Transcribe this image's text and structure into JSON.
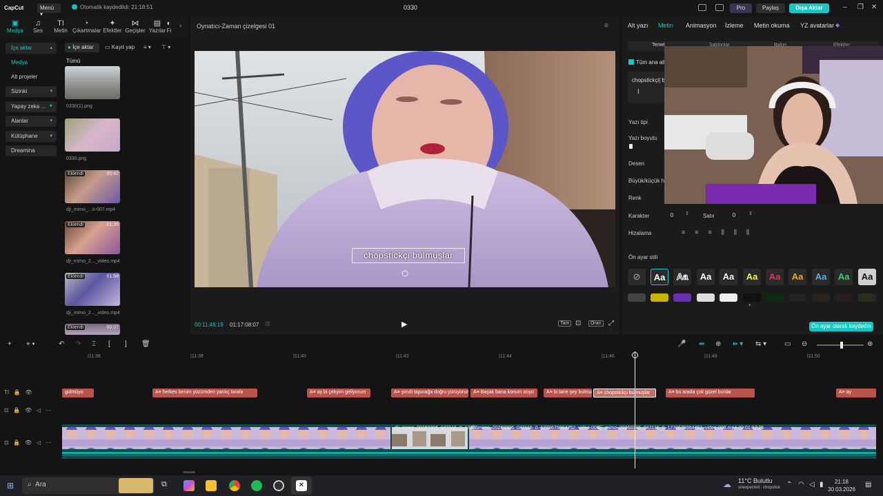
{
  "titlebar": {
    "app_logo": "CapCut",
    "menu": "Menü",
    "autosave": "Otomatik kaydedildi: 21:18:51",
    "project": "0330",
    "pro": "Pro",
    "share": "Paylaş",
    "export": "Dışa Aktar"
  },
  "toolbar": {
    "tools": [
      "Medya",
      "Ses",
      "Metin",
      "Çıkartmalar",
      "Efektler",
      "Geçişler",
      "Yazılar",
      "Fi"
    ]
  },
  "sidemenu": {
    "items": [
      "İçe aktar",
      "Medya",
      "Alt projeler",
      "Sizinki",
      "Yapay zeka ...",
      "Alanlar",
      "Kütüphane",
      "Dreamina"
    ]
  },
  "media": {
    "import": "İçe aktar",
    "record": "Kayıt yap",
    "all": "Tümü",
    "items": [
      {
        "name": "0330(1).png",
        "added": "",
        "duration": ""
      },
      {
        "name": "0330.png",
        "added": "",
        "duration": ""
      },
      {
        "name": "dji_mimo_...o-007.mp4",
        "added": "Eklendi",
        "duration": "05:42"
      },
      {
        "name": "dji_mimo_2..._video.mp4",
        "added": "Eklendi",
        "duration": "01:36"
      },
      {
        "name": "dji_mimo_2..._video.mp4",
        "added": "Eklendi",
        "duration": "01:58"
      },
      {
        "name": "",
        "added": "Eklendi",
        "duration": "00:07"
      }
    ]
  },
  "player": {
    "title": "Oynatıcı-Zaman çizelgesi 01",
    "subtitle": "chopstickçi bulmuşlar",
    "time_current": "00:11:46:19",
    "time_total": "01:17:08:07",
    "btn_full": "Tam",
    "btn_ratio": "Oran"
  },
  "right": {
    "tabs": [
      "Alt yazı",
      "Metin",
      "Animasyon",
      "İzleme",
      "Metin okuma",
      "YZ avatarlar"
    ],
    "subtabs": [
      "Temel",
      "Şablonlar",
      "Balon",
      "Efektler"
    ],
    "checkbox": "Tüm ana alt",
    "text_value": "chopstickçi| b",
    "labels": [
      "Yazı tipi",
      "Yazı boyutu",
      "Desen",
      "Büyük/küçük ha",
      "Renk",
      "Karakter",
      "Satır",
      "Hizalama",
      "Ön ayar stili"
    ],
    "char_value": "0",
    "line_value": "0",
    "preset_text": "Aa",
    "save_preset": "Ön ayar olarak kaydedin"
  },
  "timeline": {
    "ruler": [
      "|11:36",
      "|11:38",
      "|11:40",
      "|11:42",
      "|11:44",
      "|11:46",
      "|11:48",
      "|11:50"
    ],
    "subtitles": [
      "gülmüyo",
      "A≡ herkes benim yüzümden yarılıç tarafa",
      "A≡ ay bi çekyim geliyorum",
      "A≡ şimdi tapınağa doğru yürüyorum",
      "A≡ Başak bana konum atıyo",
      "A≡ bi tane şey bulmu",
      "A≡ chopstickçi bulmuşlar",
      "A≡ bu arada çok güzel bunlar",
      "A≡ ay"
    ],
    "video_labels": [
      "dji_mimo_20260306_042116_0_17736",
      "dji_mimo_20260306_042116_0_1773675984752_video-008",
      "dji_mimo_20260306_042116_0_1773675984752_video-008.mp4   00:01:02:25"
    ]
  },
  "taskbar": {
    "search": "Ara",
    "weather_temp": "11°C",
    "weather_text": "Bulutlu",
    "weather_sub": "unexpected : chopstick",
    "time": "21:18",
    "date": "30.03.2026"
  }
}
